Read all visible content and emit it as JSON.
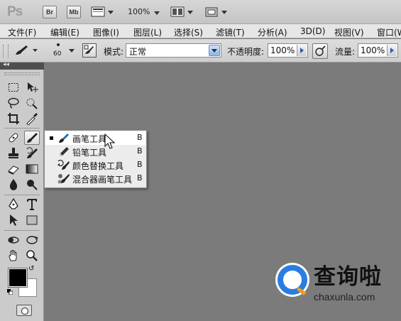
{
  "appbar": {
    "logo": "Ps",
    "bridge_button": "Br",
    "minibridge_button": "Mb",
    "zoom": "100%",
    "icons": [
      "view-extras-icon",
      "arrange-documents-icon",
      "screen-mode-icon"
    ]
  },
  "menubar": {
    "items": [
      {
        "label": "文件(F)"
      },
      {
        "label": "编辑(E)"
      },
      {
        "label": "图像(I)"
      },
      {
        "label": "图层(L)"
      },
      {
        "label": "选择(S)"
      },
      {
        "label": "滤镜(T)"
      },
      {
        "label": "分析(A)"
      },
      {
        "label": "3D(D)"
      },
      {
        "label": "视图(V)"
      },
      {
        "label": "窗口(W)"
      }
    ]
  },
  "options": {
    "brush_size": "60",
    "mode_label": "模式:",
    "mode_value": "正常",
    "opacity_label": "不透明度:",
    "opacity_value": "100%",
    "flow_label": "流量:",
    "flow_value": "100%"
  },
  "toolbox": {
    "collapse_glyph": "◂◂",
    "tools": [
      "rectangular-marquee-icon",
      "move-icon",
      "lasso-icon",
      "quick-selection-icon",
      "crop-icon",
      "eyedropper-icon",
      "spot-healing-icon",
      "brush-icon",
      "clone-stamp-icon",
      "history-brush-icon",
      "eraser-icon",
      "gradient-icon",
      "blur-icon",
      "dodge-icon",
      "pen-icon",
      "type-icon",
      "path-selection-icon",
      "shape-icon",
      "3d-rotate-icon",
      "3d-orbit-icon",
      "hand-icon",
      "zoom-icon"
    ],
    "foreground_color": "#000000",
    "background_color": "#ffffff"
  },
  "flyout": {
    "items": [
      {
        "label": "画笔工具",
        "shortcut": "B",
        "selected": true,
        "icon": "brush-icon"
      },
      {
        "label": "铅笔工具",
        "shortcut": "B",
        "selected": false,
        "icon": "pencil-icon"
      },
      {
        "label": "颜色替换工具",
        "shortcut": "B",
        "selected": false,
        "icon": "color-replacement-icon"
      },
      {
        "label": "混合器画笔工具",
        "shortcut": "B",
        "selected": false,
        "icon": "mixer-brush-icon"
      }
    ]
  },
  "canvas_color": "#7b7b7b",
  "watermark": {
    "text": "查询啦",
    "url": "chaxunla.com",
    "brand_color": "#2a7de0"
  }
}
